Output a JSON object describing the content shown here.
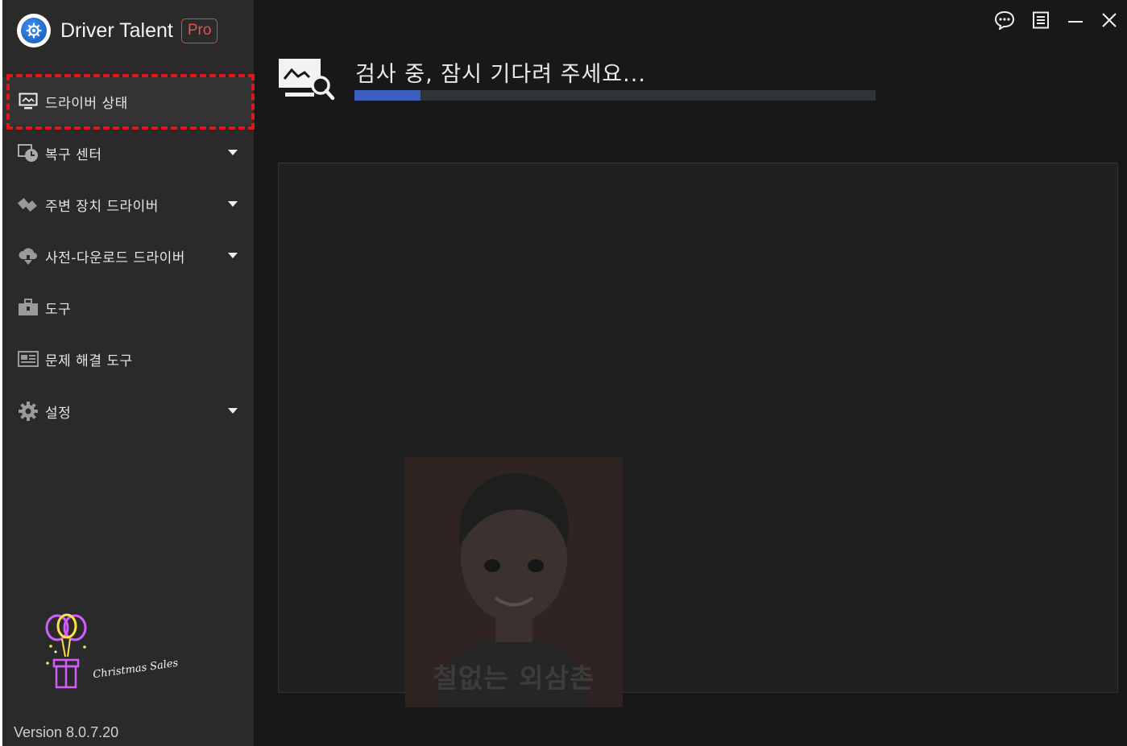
{
  "app": {
    "name": "Driver Talent",
    "badge": "Pro",
    "version": "Version 8.0.7.20"
  },
  "sidebar": {
    "items": [
      {
        "label": "드라이버 상태",
        "icon": "monitor-icon",
        "has_submenu": false,
        "active": true
      },
      {
        "label": "복구 센터",
        "icon": "restore-clock-icon",
        "has_submenu": true
      },
      {
        "label": "주변 장치 드라이버",
        "icon": "peripheral-icon",
        "has_submenu": true
      },
      {
        "label": "사전-다운로드 드라이버",
        "icon": "cloud-download-icon",
        "has_submenu": true
      },
      {
        "label": "도구",
        "icon": "toolbox-icon",
        "has_submenu": false
      },
      {
        "label": "문제 해결 도구",
        "icon": "troubleshoot-icon",
        "has_submenu": false
      },
      {
        "label": "설정",
        "icon": "gear-icon",
        "has_submenu": true
      }
    ],
    "promo": {
      "text": "Christmas Sales",
      "icon": "balloon-gift-icon"
    }
  },
  "window_controls": [
    "chat-icon",
    "menu-list-icon",
    "minimize-icon",
    "close-icon"
  ],
  "scan": {
    "title": "검사 중, 잠시 기다려 주세요...",
    "progress": 0.127
  },
  "watermark": {
    "text": "철없는 외삼촌"
  },
  "colors": {
    "sidebar_bg": "#2a2a2a",
    "main_bg": "#181818",
    "progress_fill": "#3b5dbf",
    "progress_track": "#2e3438",
    "highlight": "#e3141b",
    "pro_badge": "#d8493e"
  }
}
